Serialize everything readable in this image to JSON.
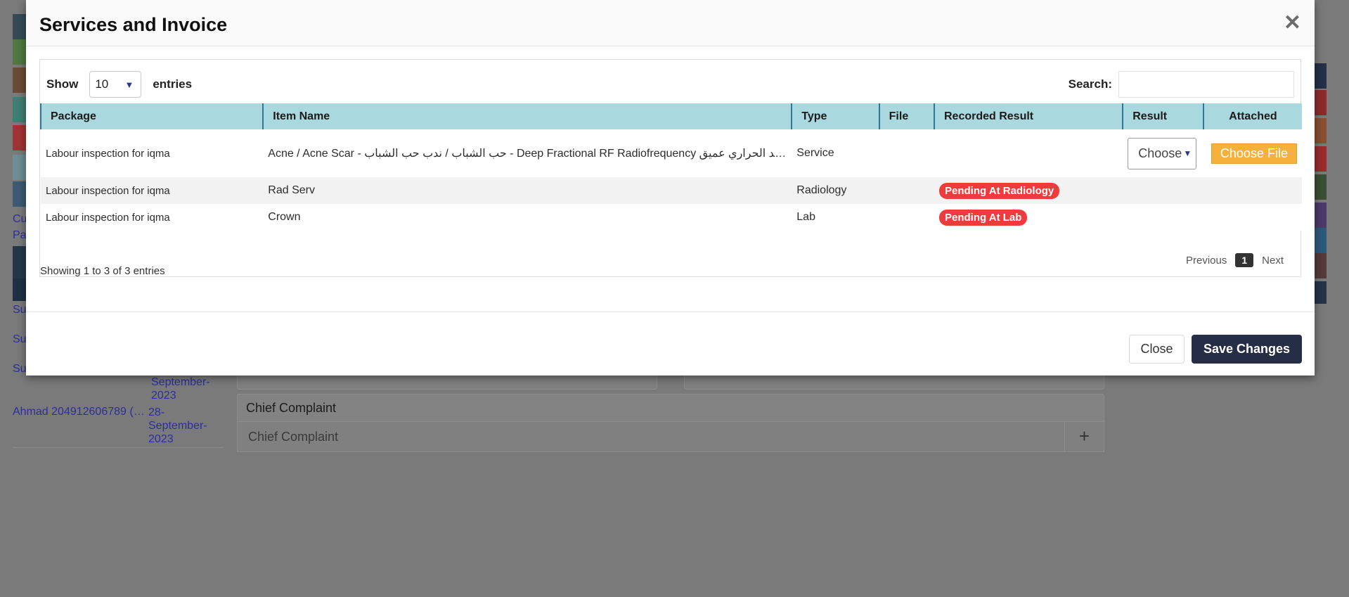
{
  "colors": {
    "overlay": "#7a7a7a",
    "table_header": "#a9d9de",
    "badge": "#ee3b3b",
    "file_button": "#f5b13a",
    "save_button": "#252e44"
  },
  "background": {
    "links": [
      "Cu",
      "Pa",
      "Su",
      "Su",
      "Su"
    ],
    "ahmad_link": "Ahmad 204912606789 (…",
    "date_top": [
      "September-",
      "2023"
    ],
    "date_bottom": [
      "28-",
      "September-",
      "2023"
    ],
    "chief_complaint_label": "Chief Complaint",
    "chief_complaint_placeholder": "Chief Complaint",
    "add_icon": "plus-icon"
  },
  "modal": {
    "title": "Services and Invoice",
    "close_icon": "close-icon",
    "length": {
      "show_label": "Show",
      "value": "10",
      "entries_label": "entries"
    },
    "search": {
      "label": "Search:",
      "value": ""
    },
    "table": {
      "headers": [
        "Package",
        "Item Name",
        "Type",
        "File",
        "Recorded Result",
        "Result",
        "Attached"
      ],
      "rows": [
        {
          "package": "Labour inspection for iqma",
          "item": "Acne / Acne Scar - حب الشباب / ندب حب الشباب - Deep Fractional RF Radiofrequency فريكونسي شد الحراري عميق...",
          "type": "Service",
          "file": "",
          "recorded": "",
          "result": "Choose",
          "attached": "Choose File"
        },
        {
          "package": "Labour inspection for iqma",
          "item": "Rad Serv",
          "type": "Radiology",
          "file": "",
          "recorded": "Pending At Radiology",
          "result": "",
          "attached": ""
        },
        {
          "package": "Labour inspection for iqma",
          "item": "Crown",
          "type": "Lab",
          "file": "",
          "recorded": "Pending At Lab",
          "result": "",
          "attached": ""
        }
      ]
    },
    "info": "Showing 1 to 3 of 3 entries",
    "pagination": {
      "previous": "Previous",
      "current": "1",
      "next": "Next"
    },
    "footer": {
      "close": "Close",
      "save": "Save Changes"
    }
  }
}
